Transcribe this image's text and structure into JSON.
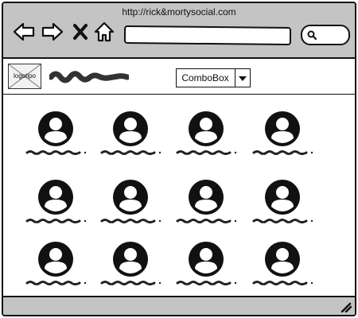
{
  "browser": {
    "url": "http://rick&mortysocial.com",
    "icons": [
      "back-arrow-icon",
      "forward-arrow-icon",
      "close-icon",
      "home-icon",
      "search-icon"
    ],
    "address_value": ""
  },
  "header": {
    "logo_text": "logotipo",
    "combo_value": "ComboBox",
    "combo_icon": "chevron-down-icon"
  },
  "profiles": {
    "count": 12,
    "avatar_icon": "user-avatar-icon"
  },
  "colors": {
    "chrome": "#c4c4c4",
    "ink": "#111111"
  }
}
